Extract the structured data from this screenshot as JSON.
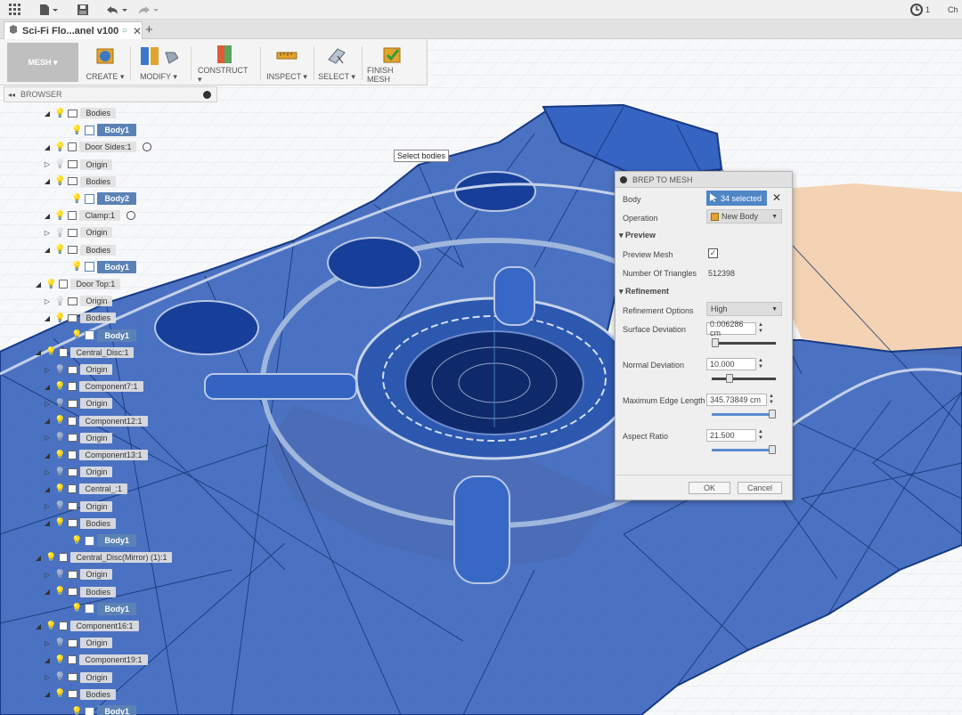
{
  "app": {
    "clock_count": "1",
    "user_initials": "Ch"
  },
  "document": {
    "tab_title": "Sci-Fi Flo...anel v100*"
  },
  "ribbon": {
    "workspace": "MESH ▾",
    "buttons": [
      "CREATE ▾",
      "MODIFY ▾",
      "CONSTRUCT ▾",
      "INSPECT ▾",
      "SELECT ▾",
      "FINISH MESH"
    ]
  },
  "browser": {
    "title": "BROWSER",
    "nodes": [
      {
        "label": "Bodies",
        "kind": "folder"
      },
      {
        "label": "Body1",
        "kind": "body"
      },
      {
        "label": "Door Sides:1",
        "kind": "component"
      },
      {
        "label": "Origin",
        "kind": "folder"
      },
      {
        "label": "Bodies",
        "kind": "folder"
      },
      {
        "label": "Body2",
        "kind": "body"
      },
      {
        "label": "Clamp:1",
        "kind": "component"
      },
      {
        "label": "Origin",
        "kind": "folder"
      },
      {
        "label": "Bodies",
        "kind": "folder"
      },
      {
        "label": "Body1",
        "kind": "body"
      },
      {
        "label": "Door Top:1",
        "kind": "component"
      },
      {
        "label": "Origin",
        "kind": "folder"
      },
      {
        "label": "Bodies",
        "kind": "folder"
      },
      {
        "label": "Body1",
        "kind": "body"
      },
      {
        "label": "Central_Disc:1",
        "kind": "component"
      },
      {
        "label": "Origin",
        "kind": "folder"
      },
      {
        "label": "Component7:1",
        "kind": "component"
      },
      {
        "label": "Origin",
        "kind": "folder"
      },
      {
        "label": "Component12:1",
        "kind": "component"
      },
      {
        "label": "Origin",
        "kind": "folder"
      },
      {
        "label": "Component13:1",
        "kind": "component"
      },
      {
        "label": "Origin",
        "kind": "folder"
      },
      {
        "label": "Central_:1",
        "kind": "component"
      },
      {
        "label": "Origin",
        "kind": "folder"
      },
      {
        "label": "Bodies",
        "kind": "folder"
      },
      {
        "label": "Body1",
        "kind": "body"
      },
      {
        "label": "Central_Disc(Mirror) (1):1",
        "kind": "component"
      },
      {
        "label": "Origin",
        "kind": "folder"
      },
      {
        "label": "Bodies",
        "kind": "folder"
      },
      {
        "label": "Body1",
        "kind": "body"
      },
      {
        "label": "Component16:1",
        "kind": "component"
      },
      {
        "label": "Origin",
        "kind": "folder"
      },
      {
        "label": "Component19:1",
        "kind": "component"
      },
      {
        "label": "Origin",
        "kind": "folder"
      },
      {
        "label": "Bodies",
        "kind": "folder"
      },
      {
        "label": "Body1",
        "kind": "body"
      }
    ]
  },
  "tooltip": "Select bodies",
  "dialog": {
    "title": "BREP TO MESH",
    "body_label": "Body",
    "body_value": "34 selected",
    "operation_label": "Operation",
    "operation_value": "New Body",
    "preview_section": "Preview",
    "preview_mesh_label": "Preview Mesh",
    "preview_mesh_checked": true,
    "triangles_label": "Number Of Triangles",
    "triangles_value": "512398",
    "refinement_section": "Refinement",
    "refinement_options_label": "Refinement Options",
    "refinement_options_value": "High",
    "surface_dev_label": "Surface Deviation",
    "surface_dev_value": "0.006286 cm",
    "normal_dev_label": "Normal Deviation",
    "normal_dev_value": "10.000",
    "max_edge_label": "Maximum Edge Length",
    "max_edge_value": "345.73849 cm",
    "aspect_label": "Aspect Ratio",
    "aspect_value": "21.500",
    "ok": "OK",
    "cancel": "Cancel",
    "sliders": {
      "surface_deviation": 0.0,
      "normal_deviation": 0.25,
      "max_edge_length": 1.0,
      "aspect_ratio": 1.0
    }
  },
  "colors": {
    "mesh_blue": "#1f4fa8",
    "floor_tan": "#f3d3b3",
    "selected_body": "#5b82b5",
    "accent": "#2f6fd6"
  }
}
